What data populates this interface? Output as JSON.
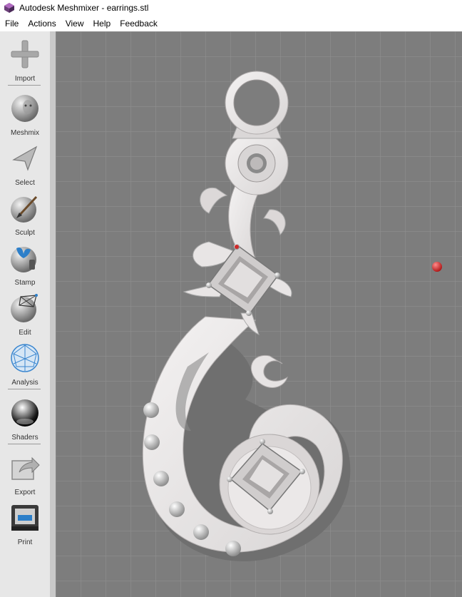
{
  "window": {
    "title": "Autodesk Meshmixer - earrings.stl"
  },
  "menu": [
    "File",
    "Actions",
    "View",
    "Help",
    "Feedback"
  ],
  "tools": [
    {
      "label": "Import",
      "icon": "plus-icon"
    },
    {
      "label": "Meshmix",
      "icon": "meshmix-head-icon"
    },
    {
      "label": "Select",
      "icon": "select-arrow-icon"
    },
    {
      "label": "Sculpt",
      "icon": "sculpt-brush-icon"
    },
    {
      "label": "Stamp",
      "icon": "stamp-icon"
    },
    {
      "label": "Edit",
      "icon": "edit-mesh-icon"
    },
    {
      "label": "Analysis",
      "icon": "analysis-mesh-icon"
    },
    {
      "label": "Shaders",
      "icon": "shader-sphere-icon"
    },
    {
      "label": "Export",
      "icon": "export-icon"
    },
    {
      "label": "Print",
      "icon": "printer-icon"
    }
  ],
  "colors": {
    "viewport": "#7d7d7d",
    "grid": "#8e8e8e",
    "model": "#e9e6e6",
    "pivot": "#e03030"
  }
}
